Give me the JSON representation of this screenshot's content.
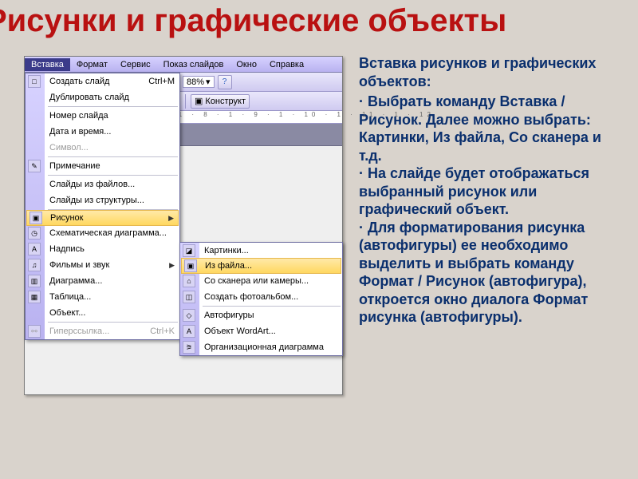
{
  "title": "Рисунки и графические объекты",
  "menubar": [
    "Вставка",
    "Формат",
    "Сервис",
    "Показ слайдов",
    "Окно",
    "Справка"
  ],
  "toolbar": {
    "zoom": "88%",
    "konstruktor": "Конструкт"
  },
  "ruler": "· 5 · 1 · 6 · 1 · 7 · 1 · 8 · 1 · 9 · 1 · 10 · 1 · 11 · 1 · 12",
  "menu": {
    "items": [
      {
        "label": "Создать слайд",
        "shortcut": "Ctrl+M",
        "icon": "□"
      },
      {
        "label": "Дублировать слайд"
      },
      {
        "label": "Номер слайда"
      },
      {
        "label": "Дата и время..."
      },
      {
        "label": "Символ...",
        "dim": true
      },
      {
        "label": "Примечание",
        "icon": "✎"
      },
      {
        "label": "Слайды из файлов..."
      },
      {
        "label": "Слайды из структуры..."
      },
      {
        "label": "Рисунок",
        "icon": "▣",
        "arrow": true,
        "hl": true
      },
      {
        "label": "Схематическая диаграмма...",
        "icon": "◷"
      },
      {
        "label": "Надпись",
        "icon": "A"
      },
      {
        "label": "Фильмы и звук",
        "icon": "♫",
        "arrow": true
      },
      {
        "label": "Диаграмма...",
        "icon": "▥"
      },
      {
        "label": "Таблица...",
        "icon": "▦"
      },
      {
        "label": "Объект..."
      },
      {
        "label": "Гиперссылка...",
        "shortcut": "Ctrl+K",
        "icon": "⚯",
        "dim": true
      }
    ]
  },
  "submenu": {
    "items": [
      {
        "label": "Картинки...",
        "icon": "◪"
      },
      {
        "label": "Из файла...",
        "icon": "▣",
        "hl": true
      },
      {
        "label": "Со сканера или камеры...",
        "icon": "⌂"
      },
      {
        "label": "Создать фотоальбом...",
        "icon": "◫"
      },
      {
        "label": "Автофигуры",
        "icon": "◇"
      },
      {
        "label": "Объект WordArt...",
        "icon": "A"
      },
      {
        "label": "Организационная диаграмма",
        "icon": "⚞"
      }
    ]
  },
  "text": {
    "heading": "Вставка рисунков и графических объектов:",
    "b1": "·  Выбрать команду Вставка / Рисунок. Далее можно выбрать: Картинки, Из файла, Со сканера и т.д.",
    "b2": "·  На слайде будет отображаться выбранный рисунок или графический объект.",
    "b3": "·   Для форматирования рисунка (автофигуры) ее необходимо выделить и выбрать команду Формат / Рисунок (автофигура), откроется окно диалога Формат рисунка (автофигуры)."
  }
}
